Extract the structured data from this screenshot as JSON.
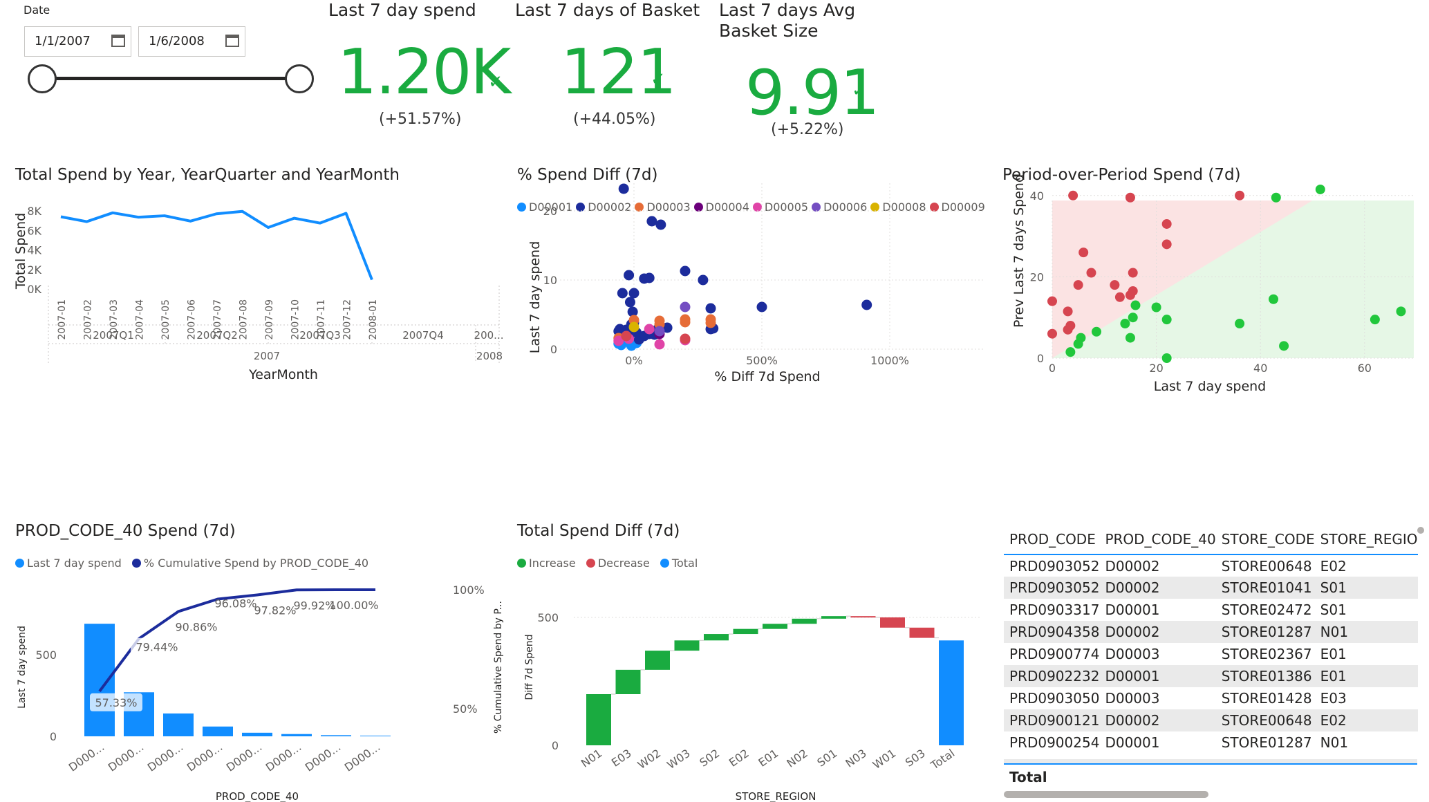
{
  "slicer": {
    "label": "Date",
    "start_date": "1/1/2007",
    "end_date": "1/6/2008"
  },
  "kpis": [
    {
      "title": "Last 7 day spend",
      "value": "1.20K",
      "delta": "(+51.57%)"
    },
    {
      "title": "Last 7 days of Basket",
      "value": "121",
      "delta": "(+44.05%)"
    },
    {
      "title_line1": "Last 7 days Avg",
      "title_line2": "Basket Size",
      "value": "9.91",
      "delta": "(+5.22%)"
    }
  ],
  "colors": {
    "accent": "#118dff",
    "positive": "#1aab40",
    "negative": "#d64550",
    "navy": "#1c2c9c"
  },
  "chart_data": [
    {
      "id": "total_spend",
      "type": "line",
      "title": "Total Spend by Year, YearQuarter and YearMonth",
      "xlabel": "YearMonth",
      "ylabel": "Total Spend",
      "categories": [
        "2007-01",
        "2007-02",
        "2007-03",
        "2007-04",
        "2007-05",
        "2007-06",
        "2007-07",
        "2007-08",
        "2007-09",
        "2007-10",
        "2007-11",
        "2007-12",
        "2008-01"
      ],
      "values": [
        7400,
        6900,
        7800,
        7350,
        7500,
        6950,
        7700,
        7950,
        6300,
        7250,
        6750,
        7750,
        950
      ],
      "quarters": [
        "2007Q1",
        "2007Q2",
        "2007Q3",
        "2007Q4",
        "200..."
      ],
      "years": [
        "2007",
        "2008"
      ],
      "yticks": [
        "0K",
        "2K",
        "4K",
        "6K",
        "8K"
      ],
      "ylim": [
        0,
        8000
      ]
    },
    {
      "id": "pct_spend_diff",
      "type": "scatter",
      "title": "% Spend Diff (7d)",
      "xlabel": "% Diff 7d Spend",
      "ylabel": "Last 7 day spend",
      "xticks": [
        "0%",
        "500%",
        "1000%"
      ],
      "yticks": [
        "0",
        "10",
        "20"
      ],
      "xlim": [
        -100,
        1000
      ],
      "ylim": [
        0,
        23
      ],
      "series": [
        {
          "name": "D00001",
          "color": "#118dff",
          "points": [
            [
              -60,
              0.8
            ],
            [
              -30,
              1.1
            ],
            [
              -10,
              0.5
            ],
            [
              10,
              0.9
            ],
            [
              -50,
              0.6
            ]
          ]
        },
        {
          "name": "D00002",
          "color": "#1c2c9c",
          "points": [
            [
              -40,
              23.2
            ],
            [
              -20,
              10.7
            ],
            [
              70,
              18.5
            ],
            [
              105,
              18.0
            ],
            [
              -45,
              8.1
            ],
            [
              0,
              8.1
            ],
            [
              -15,
              6.8
            ],
            [
              -5,
              5.4
            ],
            [
              40,
              10.2
            ],
            [
              60,
              10.3
            ],
            [
              200,
              11.3
            ],
            [
              270,
              10.0
            ],
            [
              500,
              6.1
            ],
            [
              300,
              5.9
            ],
            [
              300,
              2.9
            ],
            [
              310,
              3.0
            ],
            [
              910,
              6.4
            ],
            [
              -20,
              2.5
            ],
            [
              -55,
              2.9
            ],
            [
              -60,
              2.6
            ],
            [
              -30,
              2.8
            ],
            [
              -10,
              3.6
            ],
            [
              0,
              3.8
            ],
            [
              20,
              1.4
            ],
            [
              40,
              1.9
            ],
            [
              90,
              2.8
            ],
            [
              130,
              3.1
            ],
            [
              60,
              2.2
            ],
            [
              80,
              2.1
            ],
            [
              -40,
              1.9
            ],
            [
              -20,
              1.6
            ],
            [
              10,
              2.4
            ]
          ]
        },
        {
          "name": "D00003",
          "color": "#e66c37",
          "points": [
            [
              0,
              4.2
            ],
            [
              100,
              4.1
            ],
            [
              200,
              4.3
            ],
            [
              300,
              4.3
            ],
            [
              -60,
              1.6
            ],
            [
              100,
              3.6
            ],
            [
              200,
              3.9
            ],
            [
              300,
              3.8
            ]
          ]
        },
        {
          "name": "D00004",
          "color": "#6b007b",
          "points": [
            [
              100,
              2.2
            ]
          ]
        },
        {
          "name": "D00005",
          "color": "#e044a7",
          "points": [
            [
              -60,
              1.2
            ],
            [
              60,
              2.9
            ],
            [
              100,
              0.7
            ],
            [
              200,
              1.3
            ],
            [
              -20,
              1.5
            ]
          ]
        },
        {
          "name": "D00006",
          "color": "#744ec2",
          "points": [
            [
              200,
              6.1
            ],
            [
              100,
              2.6
            ]
          ]
        },
        {
          "name": "D00008",
          "color": "#d9b300",
          "points": [
            [
              0,
              3.2
            ]
          ]
        },
        {
          "name": "D00009",
          "color": "#d64550",
          "points": [
            [
              200,
              1.5
            ],
            [
              -30,
              1.9
            ]
          ]
        }
      ]
    },
    {
      "id": "pop_spend",
      "type": "scatter",
      "title": "Period-over-Period Spend (7d)",
      "xlabel": "Last 7 day spend",
      "ylabel": "Prev Last 7 days Spend",
      "xticks": [
        "0",
        "20",
        "40",
        "60"
      ],
      "yticks": [
        "0",
        "20",
        "40"
      ],
      "xlim": [
        0,
        68
      ],
      "ylim": [
        0,
        50
      ],
      "series": [
        {
          "name": "Decrease",
          "color": "#d64550",
          "points": [
            [
              4,
              40
            ],
            [
              15,
              39.5
            ],
            [
              36,
              40
            ],
            [
              22,
              33
            ],
            [
              22,
              28
            ],
            [
              6,
              26
            ],
            [
              7.5,
              21
            ],
            [
              15.5,
              21
            ],
            [
              5,
              18
            ],
            [
              12,
              18
            ],
            [
              13,
              15
            ],
            [
              15,
              15.5
            ],
            [
              15.5,
              16.5
            ],
            [
              0,
              14
            ],
            [
              3,
              11.5
            ],
            [
              3.5,
              8
            ],
            [
              3,
              7
            ],
            [
              0,
              6
            ]
          ]
        },
        {
          "name": "Increase",
          "color": "#21c73c",
          "points": [
            [
              43,
              39.5
            ],
            [
              51.5,
              41.5
            ],
            [
              16,
              13
            ],
            [
              20,
              12.5
            ],
            [
              22,
              9.5
            ],
            [
              15.5,
              10
            ],
            [
              14,
              8.5
            ],
            [
              8.5,
              6.5
            ],
            [
              15,
              5
            ],
            [
              5.5,
              5
            ],
            [
              5,
              3.5
            ],
            [
              3.5,
              1.5
            ],
            [
              22,
              0
            ],
            [
              42.5,
              14.5
            ],
            [
              36,
              8.5
            ],
            [
              44.5,
              3
            ],
            [
              62,
              9.5
            ],
            [
              67,
              11.5
            ]
          ]
        }
      ]
    },
    {
      "id": "prod_code_pareto",
      "type": "bar",
      "title": "PROD_CODE_40 Spend (7d)",
      "xlabel": "PROD_CODE_40",
      "ylabel": "Last 7 day spend",
      "y2label": "% Cumulative Spend by P...",
      "legend": [
        "Last 7 day spend",
        "% Cumulative Spend by PROD_CODE_40"
      ],
      "categories": [
        "D000...",
        "D000...",
        "D000...",
        "D000...",
        "D000...",
        "D000...",
        "D000...",
        "D000..."
      ],
      "values": [
        690,
        270,
        140,
        60,
        22,
        14,
        7,
        4
      ],
      "cumulative": [
        57.33,
        79.44,
        90.86,
        96.08,
        97.82,
        99.92,
        100.0,
        100.0
      ],
      "cumulative_labels": [
        "57.33%",
        "79.44%",
        "90.86%",
        "96.08%",
        "97.82%",
        "99.92%",
        "100.00%"
      ],
      "yticks": [
        "0",
        "500"
      ],
      "y2ticks": [
        "50%",
        "100%"
      ],
      "ylim": [
        0,
        830
      ]
    },
    {
      "id": "spend_diff_waterfall",
      "type": "bar",
      "title": "Total Spend Diff (7d)",
      "xlabel": "STORE_REGION",
      "ylabel": "Diff 7d Spend",
      "legend": [
        "Increase",
        "Decrease",
        "Total"
      ],
      "categories": [
        "N01",
        "E03",
        "W02",
        "W03",
        "S02",
        "E02",
        "E01",
        "N02",
        "S01",
        "N03",
        "W01",
        "S03",
        "Total"
      ],
      "steps": [
        200,
        95,
        75,
        40,
        25,
        20,
        20,
        20,
        10,
        -5,
        -40,
        -40,
        410
      ],
      "yticks": [
        "0",
        "500"
      ],
      "ylim": [
        0,
        560
      ]
    }
  ],
  "table": {
    "columns": [
      "PROD_CODE",
      "PROD_CODE_40",
      "STORE_CODE",
      "STORE_REGIO"
    ],
    "rows": [
      [
        "PRD0903052",
        "D00002",
        "STORE00648",
        "E02"
      ],
      [
        "PRD0903052",
        "D00002",
        "STORE01041",
        "S01"
      ],
      [
        "PRD0903317",
        "D00001",
        "STORE02472",
        "S01"
      ],
      [
        "PRD0904358",
        "D00002",
        "STORE01287",
        "N01"
      ],
      [
        "PRD0900774",
        "D00003",
        "STORE02367",
        "E01"
      ],
      [
        "PRD0902232",
        "D00001",
        "STORE01386",
        "E01"
      ],
      [
        "PRD0903050",
        "D00003",
        "STORE01428",
        "E03"
      ],
      [
        "PRD0900121",
        "D00002",
        "STORE00648",
        "E02"
      ],
      [
        "PRD0900254",
        "D00001",
        "STORE01287",
        "N01"
      ]
    ],
    "total_label": "Total"
  }
}
